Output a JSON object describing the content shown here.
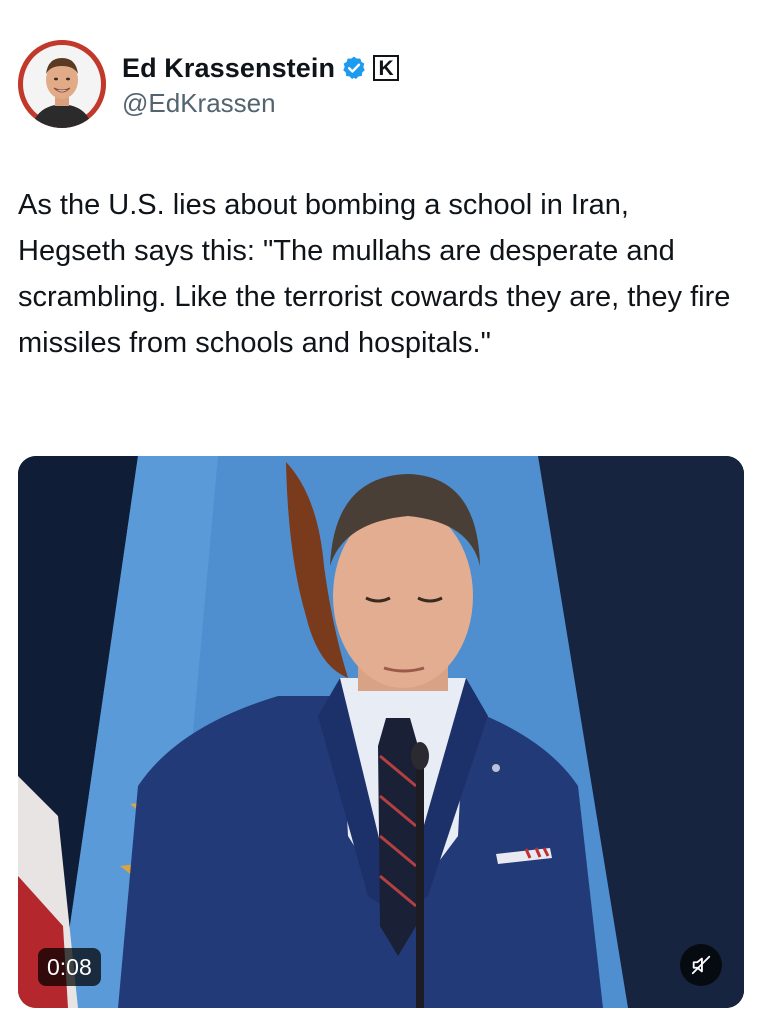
{
  "author": {
    "display_name": "Ed Krassenstein",
    "handle": "@EdKrassen",
    "verified": true,
    "badge_letter": "K",
    "verified_color": "#1d9bf0"
  },
  "tweet": {
    "text": "As the U.S. lies about bombing a school in Iran, Hegseth says this: \"The mullahs are desperate and scrambling. Like the terrorist cowards they are, they fire missiles from schools and hospitals.\""
  },
  "media": {
    "type": "video",
    "duration": "0:08",
    "muted": true,
    "mute_icon": "speaker-muted-icon"
  }
}
